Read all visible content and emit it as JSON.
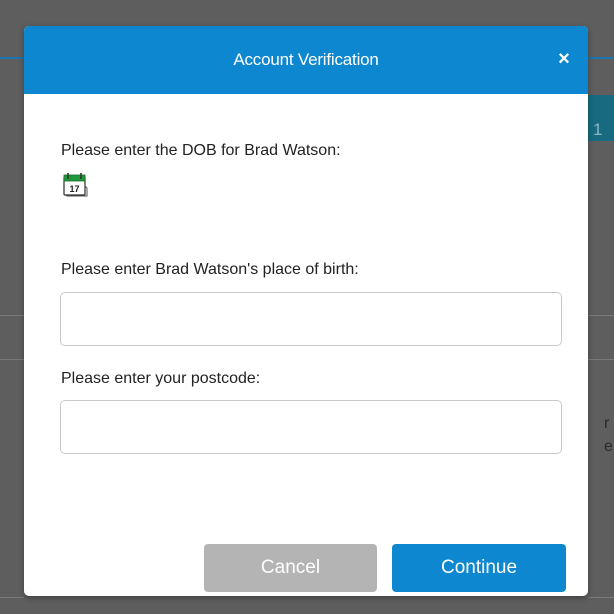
{
  "background": {
    "tab_fragment": "1",
    "text_fragments": [
      "r",
      "e"
    ]
  },
  "dialog": {
    "title": "Account Verification",
    "close_label": "×",
    "dob_label": "Please enter the DOB for Brad Watson:",
    "calendar_icon": "calendar-icon",
    "calendar_day": "17",
    "birthplace_label": "Please enter Brad Watson's place of birth:",
    "birthplace_value": "",
    "postcode_label": "Please enter your postcode:",
    "postcode_value": "",
    "cancel_label": "Cancel",
    "continue_label": "Continue"
  },
  "colors": {
    "header": "#0d87cf",
    "primary_button": "#0d87cf",
    "disabled_button": "#b4b4b4",
    "overlay": "#5e5e5e"
  }
}
